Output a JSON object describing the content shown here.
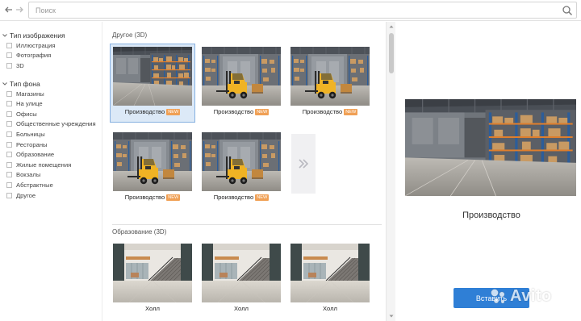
{
  "search": {
    "placeholder": "Поиск"
  },
  "sidebar": {
    "groups": [
      {
        "title": "Тип изображения",
        "items": [
          "Иллюстрация",
          "Фотография",
          "3D"
        ]
      },
      {
        "title": "Тип фона",
        "items": [
          "Магазины",
          "На улице",
          "Офисы",
          "Общественные учреждения",
          "Больницы",
          "Рестораны",
          "Образование",
          "Жилые помещения",
          "Вокзалы",
          "Абстрактные",
          "Другое"
        ]
      }
    ]
  },
  "gallery": {
    "sections": [
      {
        "title": "Другое (3D)",
        "cards": [
          {
            "label": "Производство",
            "badge": "NEW",
            "selected": true,
            "scene": "shelves"
          },
          {
            "label": "Производство",
            "badge": "NEW",
            "selected": false,
            "scene": "forklift"
          },
          {
            "label": "Производство",
            "badge": "NEW",
            "selected": false,
            "scene": "forklift"
          },
          {
            "label": "Производство",
            "badge": "NEW",
            "selected": false,
            "scene": "forklift"
          },
          {
            "label": "Производство",
            "badge": "NEW",
            "selected": false,
            "scene": "forklift"
          }
        ]
      },
      {
        "title": "Образование (3D)",
        "cards": [
          {
            "label": "Холл",
            "selected": false,
            "scene": "hall"
          },
          {
            "label": "Холл",
            "selected": false,
            "scene": "hall"
          },
          {
            "label": "Холл",
            "selected": false,
            "scene": "hall"
          }
        ]
      }
    ],
    "more_icon": "double-chevron-right-icon"
  },
  "preview": {
    "title": "Производство",
    "insert_label": "Вставить"
  },
  "watermark": {
    "text": "Avito"
  },
  "colors": {
    "accent": "#2f7fd6",
    "badge": "#f0a055",
    "selected_bg": "#dce9f7"
  }
}
